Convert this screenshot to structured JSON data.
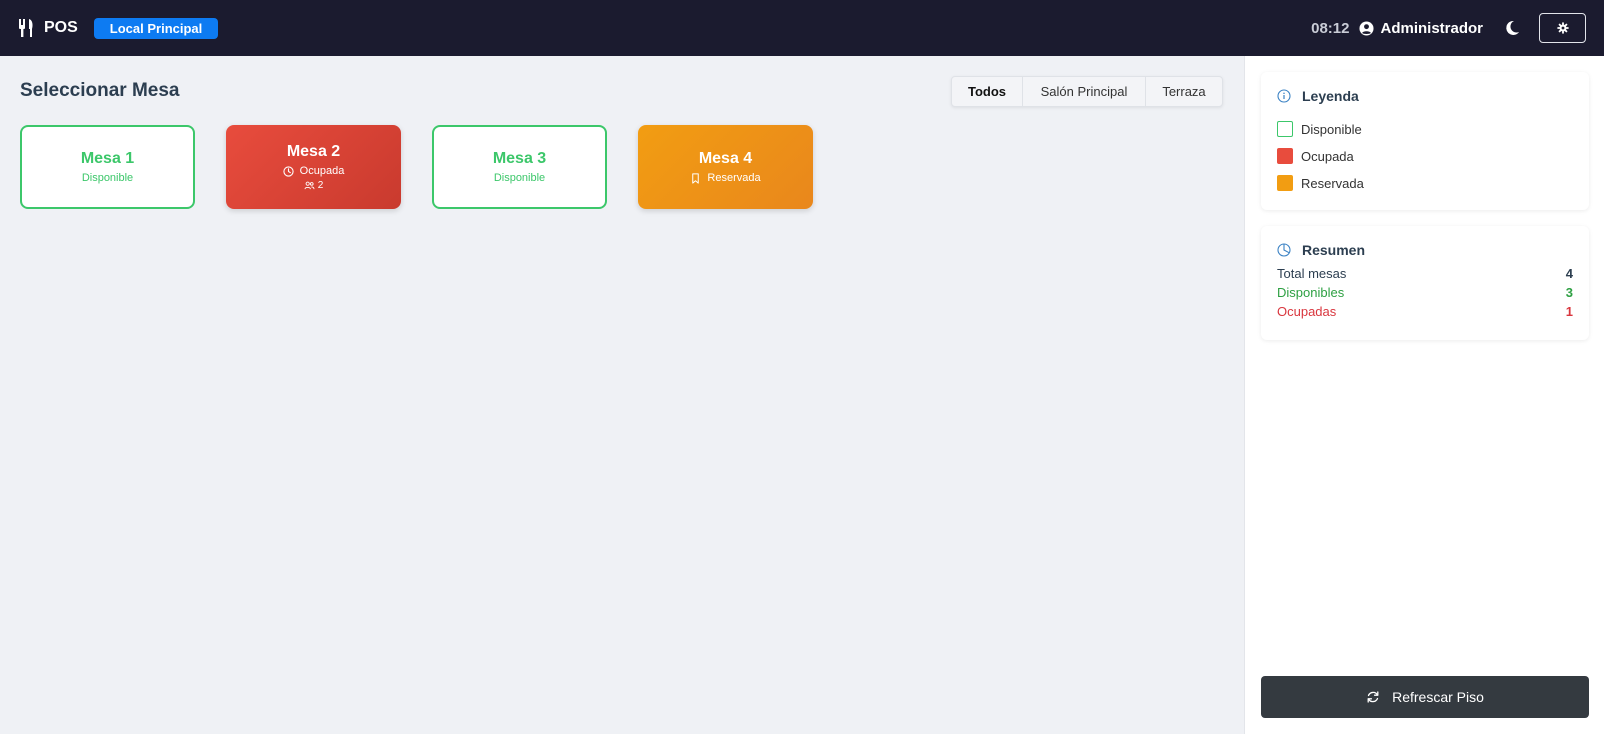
{
  "header": {
    "brand": "POS",
    "local_badge": "Local Principal",
    "time": "08:12",
    "user": "Administrador"
  },
  "main": {
    "title": "Seleccionar Mesa",
    "tabs": [
      {
        "label": "Todos",
        "active": true
      },
      {
        "label": "Salón Principal",
        "active": false
      },
      {
        "label": "Terraza",
        "active": false
      }
    ],
    "tables": [
      {
        "name": "Mesa 1",
        "status": "Disponible",
        "state": "available"
      },
      {
        "name": "Mesa 2",
        "status": "Ocupada",
        "state": "occupied",
        "guests": "2"
      },
      {
        "name": "Mesa 3",
        "status": "Disponible",
        "state": "available"
      },
      {
        "name": "Mesa 4",
        "status": "Reservada",
        "state": "reserved"
      }
    ]
  },
  "sidebar": {
    "legend": {
      "title": "Leyenda",
      "items": [
        {
          "label": "Disponible",
          "color": "#ffffff",
          "border": "#3cc76a"
        },
        {
          "label": "Ocupada",
          "color": "#e84c3d"
        },
        {
          "label": "Reservada",
          "color": "#f29d12"
        }
      ]
    },
    "summary": {
      "title": "Resumen",
      "rows": [
        {
          "label": "Total mesas",
          "value": "4",
          "color": "#2c3e50"
        },
        {
          "label": "Disponibles",
          "value": "3",
          "color": "#2ea043"
        },
        {
          "label": "Ocupadas",
          "value": "1",
          "color": "#d9363e"
        }
      ]
    },
    "refresh_label": "Refrescar Piso"
  },
  "colors": {
    "navbar": "#1b1b2f",
    "badge": "#0d7bf2",
    "available": "#3cc76a",
    "occupied": "#e84c3d",
    "reserved": "#f29d12"
  },
  "icons": {
    "brand": "utensils-icon",
    "user": "user-circle-icon",
    "theme": "moon-icon",
    "settings": "gear-icon",
    "legend": "info-circle-icon",
    "summary": "pie-chart-icon",
    "occupied_status": "clock-icon",
    "guests": "people-icon",
    "reserved_status": "bookmark-icon",
    "refresh": "refresh-icon"
  }
}
